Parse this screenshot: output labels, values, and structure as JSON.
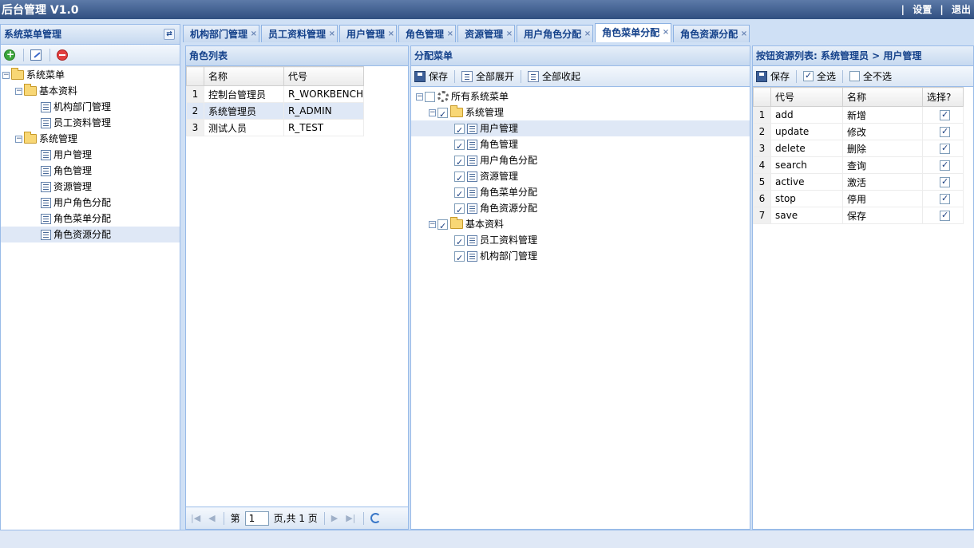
{
  "app": {
    "title": "后台管理 V1.0",
    "settings": "设置",
    "logout": "退出"
  },
  "left": {
    "title": "系统菜单管理",
    "tree": [
      {
        "label": "系统菜单",
        "level": 0,
        "type": "folder"
      },
      {
        "label": "基本资料",
        "level": 1,
        "type": "folder"
      },
      {
        "label": "机构部门管理",
        "level": 2,
        "type": "leaf"
      },
      {
        "label": "员工资料管理",
        "level": 2,
        "type": "leaf"
      },
      {
        "label": "系统管理",
        "level": 1,
        "type": "folder"
      },
      {
        "label": "用户管理",
        "level": 2,
        "type": "leaf"
      },
      {
        "label": "角色管理",
        "level": 2,
        "type": "leaf"
      },
      {
        "label": "资源管理",
        "level": 2,
        "type": "leaf"
      },
      {
        "label": "用户角色分配",
        "level": 2,
        "type": "leaf"
      },
      {
        "label": "角色菜单分配",
        "level": 2,
        "type": "leaf"
      },
      {
        "label": "角色资源分配",
        "level": 2,
        "type": "leaf",
        "selected": true
      }
    ]
  },
  "tabs": [
    "机构部门管理",
    "员工资料管理",
    "用户管理",
    "角色管理",
    "资源管理",
    "用户角色分配",
    "角色菜单分配",
    "角色资源分配"
  ],
  "active_tab": "角色菜单分配",
  "roles": {
    "title": "角色列表",
    "columns": [
      "名称",
      "代号"
    ],
    "rows": [
      {
        "no": "1",
        "name": "控制台管理员",
        "code": "R_WORKBENCH"
      },
      {
        "no": "2",
        "name": "系统管理员",
        "code": "R_ADMIN",
        "selected": true
      },
      {
        "no": "3",
        "name": "测试人员",
        "code": "R_TEST"
      }
    ],
    "pager": {
      "page_label": "第",
      "page": "1",
      "total": "页,共 1 页"
    }
  },
  "menu": {
    "title": "分配菜单",
    "toolbar": {
      "save": "保存",
      "expand": "全部展开",
      "collapse": "全部收起"
    },
    "tree": [
      {
        "label": "所有系统菜单",
        "level": 0,
        "type": "root",
        "checked": false
      },
      {
        "label": "系统管理",
        "level": 1,
        "type": "folder",
        "checked": true
      },
      {
        "label": "用户管理",
        "level": 2,
        "type": "leaf",
        "checked": true,
        "selected": true
      },
      {
        "label": "角色管理",
        "level": 2,
        "type": "leaf",
        "checked": true
      },
      {
        "label": "用户角色分配",
        "level": 2,
        "type": "leaf",
        "checked": true
      },
      {
        "label": "资源管理",
        "level": 2,
        "type": "leaf",
        "checked": true
      },
      {
        "label": "角色菜单分配",
        "level": 2,
        "type": "leaf",
        "checked": true
      },
      {
        "label": "角色资源分配",
        "level": 2,
        "type": "leaf",
        "checked": true
      },
      {
        "label": "基本资料",
        "level": 1,
        "type": "folder",
        "checked": true
      },
      {
        "label": "员工资料管理",
        "level": 2,
        "type": "leaf",
        "checked": true
      },
      {
        "label": "机构部门管理",
        "level": 2,
        "type": "leaf",
        "checked": true
      }
    ]
  },
  "buttons": {
    "title": "按钮资源列表: 系统管理员 > 用户管理",
    "toolbar": {
      "save": "保存",
      "select_all": "全选",
      "select_none": "全不选"
    },
    "columns": [
      "代号",
      "名称",
      "选择?"
    ],
    "rows": [
      {
        "no": "1",
        "code": "add",
        "name": "新增",
        "checked": true
      },
      {
        "no": "2",
        "code": "update",
        "name": "修改",
        "checked": true
      },
      {
        "no": "3",
        "code": "delete",
        "name": "删除",
        "checked": true
      },
      {
        "no": "4",
        "code": "search",
        "name": "查询",
        "checked": true
      },
      {
        "no": "5",
        "code": "active",
        "name": "激活",
        "checked": true
      },
      {
        "no": "6",
        "code": "stop",
        "name": "停用",
        "checked": true
      },
      {
        "no": "7",
        "code": "save",
        "name": "保存",
        "checked": true
      }
    ]
  }
}
